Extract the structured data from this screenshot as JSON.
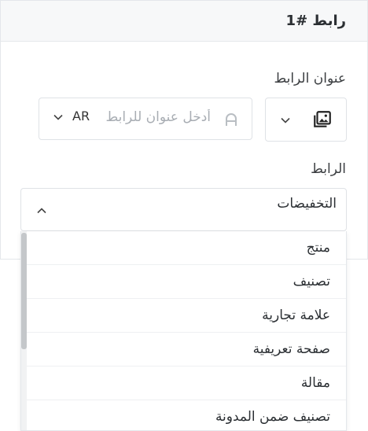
{
  "panel": {
    "title": "رابط #1"
  },
  "fields": {
    "title_label": "عنوان الرابط",
    "title_placeholder": "أدخل عنوان للرابط",
    "language": "AR",
    "link_label": "الرابط",
    "link_selected": "التخفيضات"
  },
  "icons": {
    "font": "font-a-icon",
    "image": "image-icon",
    "chevron_down": "chevron-down-icon",
    "chevron_up": "chevron-up-icon"
  },
  "dropdown": {
    "options": [
      {
        "label": "منتج"
      },
      {
        "label": "تصنيف"
      },
      {
        "label": "علامة تجارية"
      },
      {
        "label": "صفحة تعريفية"
      },
      {
        "label": "مقالة"
      },
      {
        "label": "تصنيف ضمن المدونة"
      }
    ]
  },
  "colors": {
    "border": "#dfe2e6",
    "header_bg": "#f7f8f9",
    "placeholder": "#a8adb3",
    "text": "#2b2f33"
  }
}
